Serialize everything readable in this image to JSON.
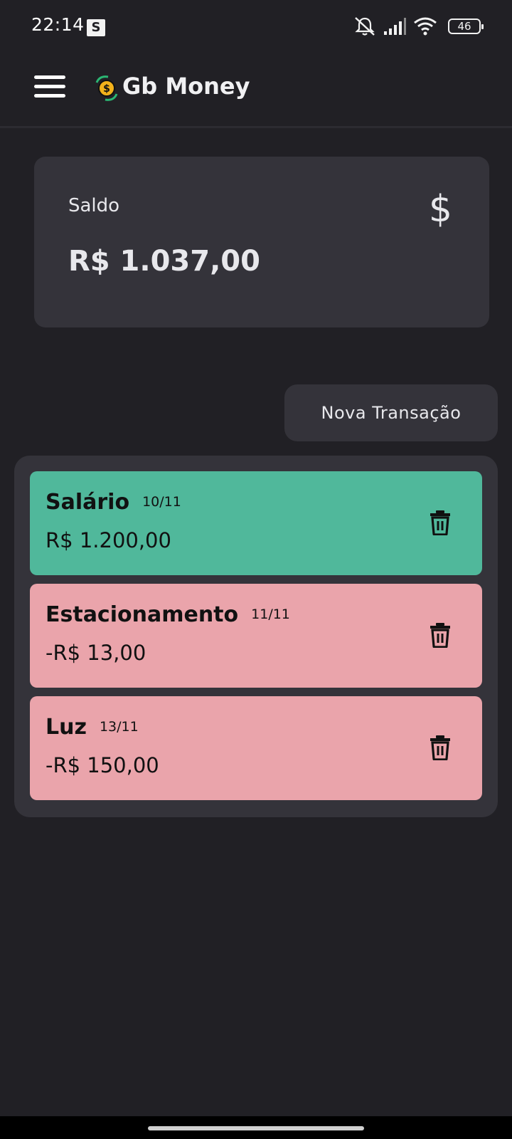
{
  "status_bar": {
    "time": "22:14",
    "notification_badge": "S",
    "battery": "46",
    "icons": [
      "muted-bell-icon",
      "signal-icon",
      "wifi-icon",
      "battery-icon"
    ]
  },
  "header": {
    "title": "Gb Money",
    "menu_icon": "hamburger-menu-icon",
    "logo_icon": "coin-exchange-logo-icon"
  },
  "balance": {
    "label": "Saldo",
    "value": "R$ 1.037,00",
    "icon": "dollar-sign-icon",
    "icon_glyph": "$"
  },
  "new_transaction_button": "Nova Transação",
  "transactions": [
    {
      "name": "Salário",
      "date": "10/11",
      "amount": "R$ 1.200,00",
      "type": "income"
    },
    {
      "name": "Estacionamento",
      "date": "11/11",
      "amount": "-R$ 13,00",
      "type": "expense"
    },
    {
      "name": "Luz",
      "date": "13/11",
      "amount": "-R$ 150,00",
      "type": "expense"
    }
  ],
  "colors": {
    "background": "#212025",
    "card": "#34333a",
    "income": "#50b89b",
    "expense": "#eaa4ab"
  }
}
